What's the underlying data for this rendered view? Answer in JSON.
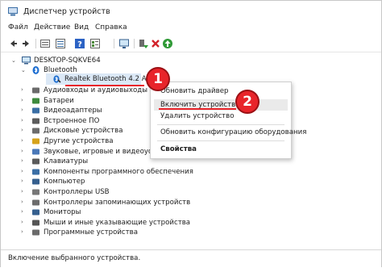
{
  "window": {
    "title": "Диспетчер устройств"
  },
  "menu": {
    "file": "Файл",
    "action": "Действие",
    "view": "Вид",
    "help": "Справка"
  },
  "toolbar": {
    "icons": [
      "back-arrow-icon",
      "forward-arrow-icon",
      "properties-icon",
      "list-icon",
      "help-icon",
      "details-icon",
      "monitor-icon",
      "enable-device-icon",
      "remove-device-icon",
      "update-driver-icon"
    ]
  },
  "tree": {
    "root": "DESKTOP-SQKVE64",
    "bluetooth": "Bluetooth",
    "bt_adapter": "Realtek Bluetooth 4.2 Adapter",
    "items": [
      "Аудиовходы и аудиовыходы",
      "Батареи",
      "Видеоадаптеры",
      "Встроенное ПО",
      "Дисковые устройства",
      "Другие устройства",
      "Звуковые, игровые и видеоустр",
      "Клавиатуры",
      "Компоненты программного обеспечения",
      "Компьютер",
      "Контроллеры USB",
      "Контроллеры запоминающих устройств",
      "Мониторы",
      "Мыши и иные указывающие устройства",
      "Программные устройства"
    ]
  },
  "context_menu": {
    "update_driver": "Обновить драйвер",
    "enable_device": "Включить устройство",
    "remove_device": "Удалить устройство",
    "scan_changes": "Обновить конфигурацию оборудования",
    "properties": "Свойства"
  },
  "callouts": {
    "one": "1",
    "two": "2"
  },
  "status": {
    "text": "Включение выбранного устройства."
  },
  "colors": {
    "callout_red": "#e8242a",
    "selection": "#dbe8f6"
  }
}
